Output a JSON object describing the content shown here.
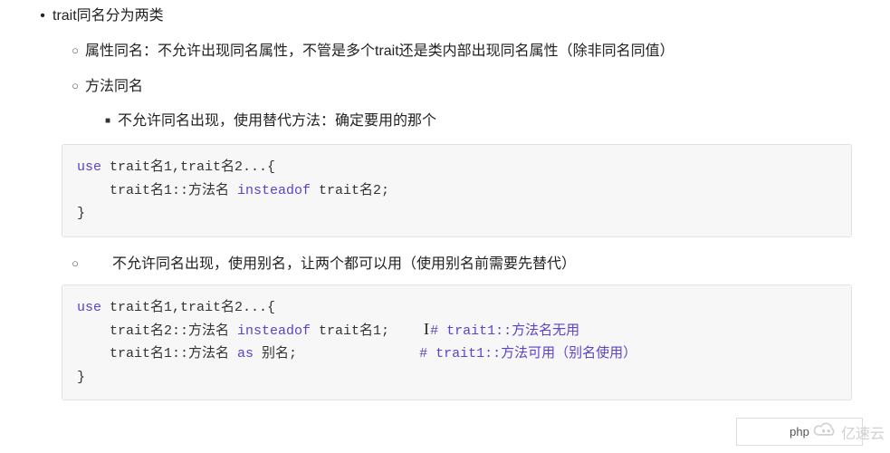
{
  "list": {
    "item0": "trait同名分为两类",
    "item1": "属性同名：不允许出现同名属性，不管是多个trait还是类内部出现同名属性（除非同名同值）",
    "item2": "方法同名",
    "item3": "不允许同名出现，使用替代方法：确定要用的那个",
    "item4": "不允许同名出现，使用别名，让两个都可以用（使用别名前需要先替代）"
  },
  "code1": {
    "kw_use": "use",
    "seg1": " trait名1,trait名2...{",
    "seg2": "    trait名1::方法名 ",
    "kw_insteadof": "insteadof",
    "seg3": " trait名2;",
    "seg4": "}"
  },
  "code2": {
    "kw_use": "use",
    "seg1": " trait名1,trait名2...{",
    "seg2": "    trait名2::方法名 ",
    "kw_insteadof": "insteadof",
    "seg3": " trait名1;     ",
    "comment1": "# trait1::方法名无用",
    "seg4": "    trait名1::方法名 ",
    "kw_as": "as",
    "seg5": " 别名;               ",
    "comment2": "# trait1::方法可用（别名使用）",
    "seg6": "}"
  },
  "lang_tag": "php",
  "watermark": "亿速云"
}
